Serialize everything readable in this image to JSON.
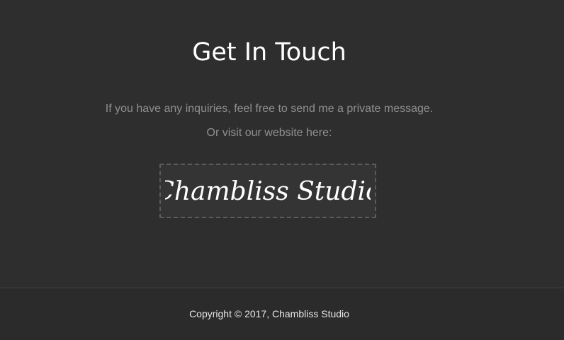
{
  "header": {
    "title": "Get In Touch"
  },
  "contact": {
    "message": "If you have any inquiries, feel free to send me a private message.",
    "website_prompt": "Or visit our website here:",
    "website_logo_text": "Chambliss Studio"
  },
  "footer": {
    "copyright": "Copyright © 2017, Chambliss Studio"
  },
  "colors": {
    "background": "#2e2e2e",
    "title": "#ffffff",
    "body_text": "#8f8f8f",
    "logo_border": "#5b5b5b",
    "footer_text": "#e6e6e6"
  }
}
